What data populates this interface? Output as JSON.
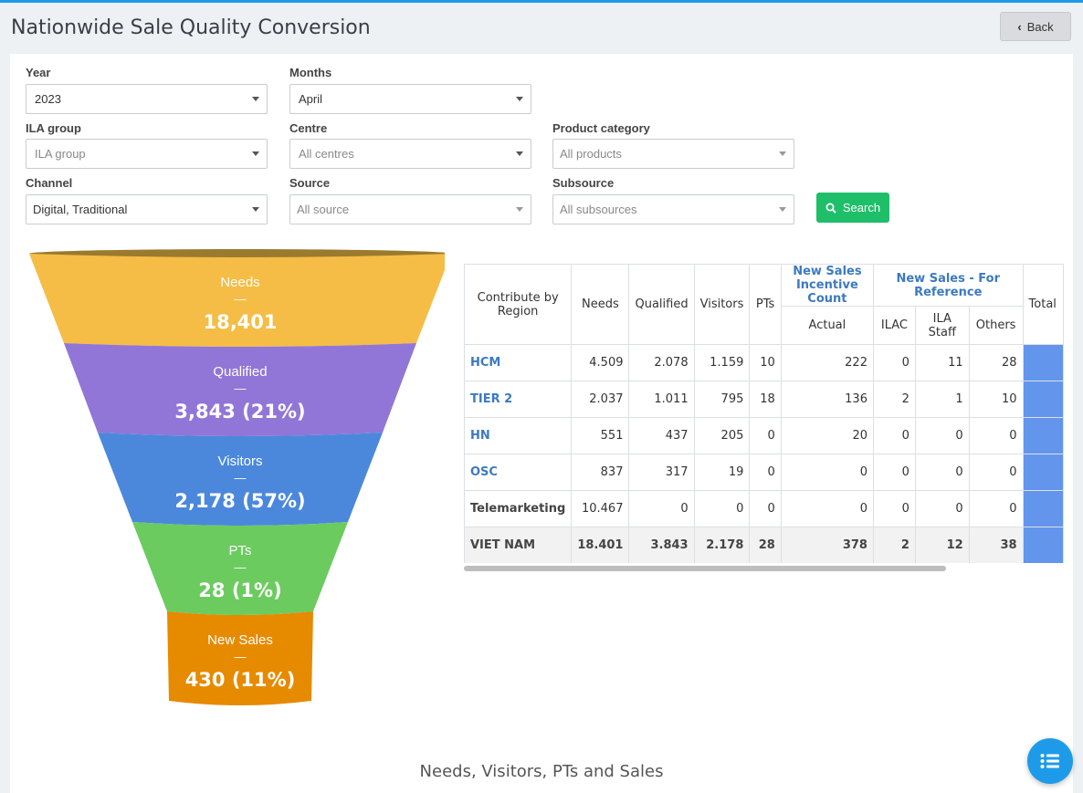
{
  "page": {
    "title": "Nationwide Sale Quality Conversion",
    "back_label": "Back"
  },
  "filters": {
    "year": {
      "label": "Year",
      "value": "2023"
    },
    "months": {
      "label": "Months",
      "value": "April"
    },
    "ila_group": {
      "label": "ILA group",
      "placeholder": "ILA group"
    },
    "centre": {
      "label": "Centre",
      "placeholder": "All centres"
    },
    "product_category": {
      "label": "Product category",
      "placeholder": "All products"
    },
    "channel": {
      "label": "Channel",
      "value": "Digital, Traditional"
    },
    "source": {
      "label": "Source",
      "placeholder": "All source"
    },
    "subsource": {
      "label": "Subsource",
      "placeholder": "All subsources"
    },
    "search_label": "Search"
  },
  "funnel": {
    "stages": [
      {
        "name": "Needs",
        "dash": "—",
        "value": "18,401",
        "color": "#f5bd45"
      },
      {
        "name": "Qualified",
        "dash": "—",
        "value": "3,843 (21%)",
        "color": "#9176d8"
      },
      {
        "name": "Visitors",
        "dash": "—",
        "value": "2,178 (57%)",
        "color": "#4b88dc"
      },
      {
        "name": "PTs",
        "dash": "—",
        "value": "28 (1%)",
        "color": "#6bcb5f"
      },
      {
        "name": "New Sales",
        "dash": "—",
        "value": "430 (11%)",
        "color": "#e68a00"
      }
    ],
    "rim_color": "#9a7a2e"
  },
  "table": {
    "headers": {
      "region": "Contribute by Region",
      "needs": "Needs",
      "qualified": "Qualified",
      "visitors": "Visitors",
      "pts": "PTs",
      "incentive": "New Sales Incentive Count",
      "reference": "New Sales - For Reference",
      "total": "Total",
      "actual": "Actual",
      "ilac": "ILAC",
      "ila_staff": "ILA Staff",
      "others": "Others"
    },
    "rows": [
      {
        "region": "HCM",
        "link": true,
        "needs": "4.509",
        "qualified": "2.078",
        "visitors": "1.159",
        "pts": "10",
        "actual": "222",
        "ilac": "0",
        "ila_staff": "11",
        "others": "28"
      },
      {
        "region": "TIER 2",
        "link": true,
        "needs": "2.037",
        "qualified": "1.011",
        "visitors": "795",
        "pts": "18",
        "actual": "136",
        "ilac": "2",
        "ila_staff": "1",
        "others": "10"
      },
      {
        "region": "HN",
        "link": true,
        "needs": "551",
        "qualified": "437",
        "visitors": "205",
        "pts": "0",
        "actual": "20",
        "ilac": "0",
        "ila_staff": "0",
        "others": "0"
      },
      {
        "region": "OSC",
        "link": true,
        "needs": "837",
        "qualified": "317",
        "visitors": "19",
        "pts": "0",
        "actual": "0",
        "ilac": "0",
        "ila_staff": "0",
        "others": "0"
      },
      {
        "region": "Telemarketing",
        "link": false,
        "needs": "10.467",
        "qualified": "0",
        "visitors": "0",
        "pts": "0",
        "actual": "0",
        "ilac": "0",
        "ila_staff": "0",
        "others": "0"
      }
    ],
    "total_row": {
      "region": "VIET NAM",
      "needs": "18.401",
      "qualified": "3.843",
      "visitors": "2.178",
      "pts": "28",
      "actual": "378",
      "ilac": "2",
      "ila_staff": "12",
      "others": "38"
    }
  },
  "bottom_title": "Needs, Visitors, PTs and Sales"
}
